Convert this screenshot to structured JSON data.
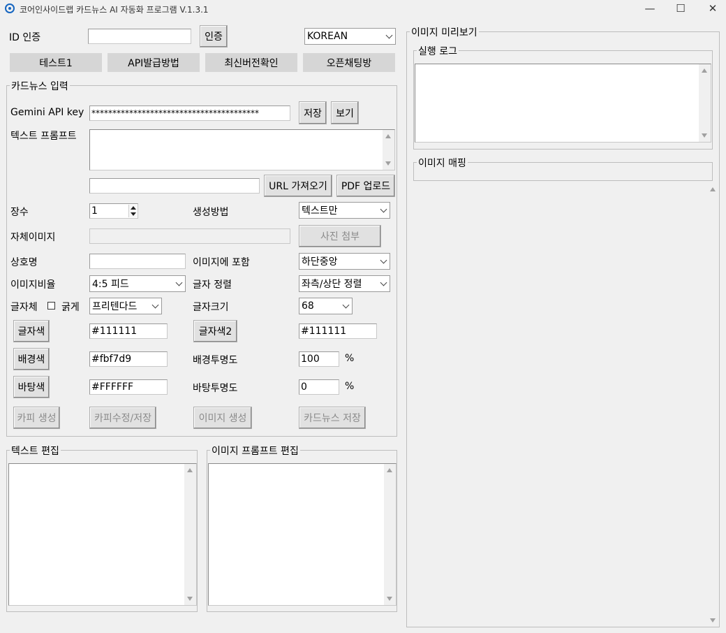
{
  "window": {
    "title": "코어인사이드랩 카드뉴스 AI 자동화 프로그램 V.1.3.1",
    "minimize": "—",
    "maximize": "☐",
    "close": "✕"
  },
  "auth": {
    "id_label": "ID 인증",
    "id_value": "",
    "auth_button": "인증",
    "language": "KOREAN"
  },
  "top_buttons": [
    "테스트1",
    "API발급방법",
    "최신버전확인",
    "오픈채팅방"
  ],
  "cardnews": {
    "group_title": "카드뉴스 입력",
    "gemini_label": "Gemini API key",
    "gemini_value": "****************************************",
    "save_button": "저장",
    "view_button": "보기",
    "prompt_label": "텍스트 프롬프트",
    "url_value": "",
    "url_button": "URL 가져오기",
    "pdf_button": "PDF 업로드",
    "count_label": "장수",
    "count_value": "1",
    "method_label": "생성방법",
    "method_value": "텍스트만",
    "own_image_label": "자체이미지",
    "photo_attach_button": "사진 첨부",
    "company_label": "상호명",
    "company_value": "",
    "include_label": "이미지에 포함",
    "include_value": "하단중앙",
    "ratio_label": "이미지비율",
    "ratio_value": "4:5 피드",
    "align_label": "글자 정렬",
    "align_value": "좌측/상단 정렬",
    "font_label": "글자체",
    "bold_label": "굵게",
    "font_value": "프리텐다드",
    "size_label": "글자크기",
    "size_value": "68",
    "text_color_button": "글자색",
    "text_color_value": "#111111",
    "text_color2_button": "글자색2",
    "text_color2_value": "#111111",
    "bg_color_button": "배경색",
    "bg_color_value": "#fbf7d9",
    "bg_opacity_label": "배경투명도",
    "bg_opacity_value": "100",
    "base_color_button": "바탕색",
    "base_color_value": "#FFFFFF",
    "base_opacity_label": "바탕투명도",
    "base_opacity_value": "0",
    "percent": "%",
    "copy_gen_button": "카피 생성",
    "copy_edit_button": "카피수정/저장",
    "image_gen_button": "이미지 생성",
    "cardnews_save_button": "카드뉴스 저장"
  },
  "text_edit": {
    "title": "텍스트 편집"
  },
  "image_prompt_edit": {
    "title": "이미지 프롬프트 편집"
  },
  "preview": {
    "title": "이미지 미리보기",
    "log_title": "실행 로그",
    "mapping_title": "이미지 매핑"
  }
}
